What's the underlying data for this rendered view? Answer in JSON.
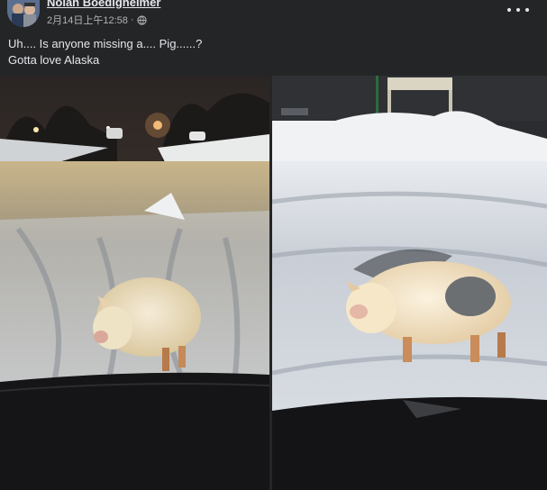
{
  "post": {
    "author": "Nolan Boedigheimer",
    "timestamp": "2月14日上午12:58",
    "separator": "·",
    "audience_icon": "globe-icon",
    "menu_icon": "more-horizontal-icon",
    "text_line1": "Uh.... Is anyone missing a.... Pig......?",
    "text_line2": "Gotta love Alaska"
  },
  "photos": [
    {
      "icon": "photo-pig-street-night"
    },
    {
      "icon": "photo-pig-snow-closeup"
    }
  ],
  "colors": {
    "background": "#242526",
    "text": "#e4e6eb",
    "secondary_text": "#b0b3b8"
  }
}
